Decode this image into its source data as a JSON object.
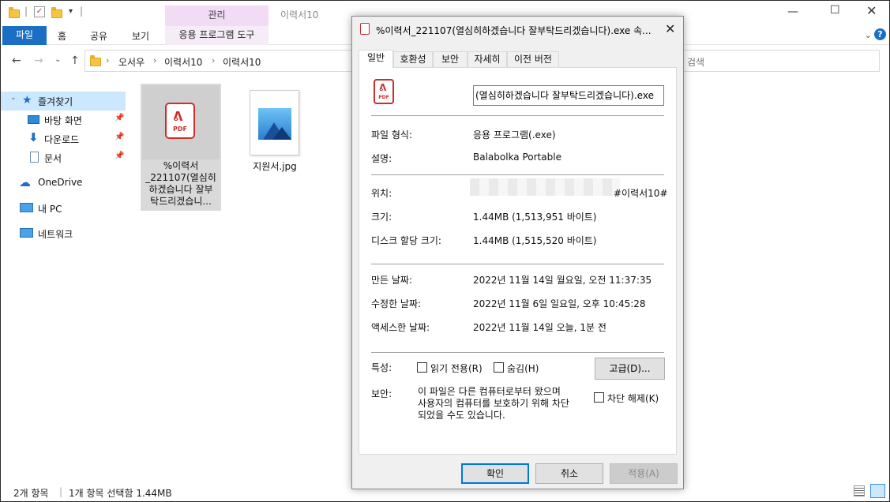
{
  "explorer": {
    "title_path": "이력서10",
    "manage_tab": "관리",
    "ribbon_tabs": {
      "file": "파일",
      "home": "홈",
      "share": "공유",
      "view": "보기",
      "app_tools": "응용 프로그램 도구"
    },
    "breadcrumb": [
      "오서우",
      "이력서10",
      "이력서10"
    ],
    "search_placeholder": "검색",
    "sidebar": {
      "quick_access": "즐겨찾기",
      "desktop": "바탕 화면",
      "downloads": "다운로드",
      "documents": "문서",
      "onedrive": "OneDrive",
      "this_pc": "내 PC",
      "network": "네트워크"
    },
    "files": [
      {
        "name_lines": [
          "%이력서",
          "_221107(열심히",
          "하겠습니다 잘부",
          "탁드리겠습니..."
        ],
        "icon_label": "PDF"
      },
      {
        "name": "지원서.jpg"
      }
    ],
    "status": {
      "item_count": "2개 항목",
      "selection": "1개 항목 선택함 1.44MB"
    }
  },
  "dialog": {
    "title": "%이력서_221107(열심히하겠습니다 잘부탁드리겠습니다).exe 속...",
    "tabs": [
      "일반",
      "호환성",
      "보안",
      "자세히",
      "이전 버전"
    ],
    "pdf_icon_text": "PDF",
    "filename_value": "(열심히하겠습니다 잘부탁드리겠습니다).exe",
    "fields": {
      "file_type_label": "파일 형식:",
      "file_type_value": "응용 프로그램(.exe)",
      "description_label": "설명:",
      "description_value": "Balabolka Portable",
      "location_label": "위치:",
      "location_value": "#이력서10#",
      "size_label": "크기:",
      "size_value": "1.44MB (1,513,951 바이트)",
      "disk_size_label": "디스크 할당 크기:",
      "disk_size_value": "1.44MB (1,515,520 바이트)",
      "created_label": "만든 날짜:",
      "created_value": "2022년 11월 14일 월요일, 오전 11:37:35",
      "modified_label": "수정한 날짜:",
      "modified_value": "2022년 11월 6일 일요일, 오후 10:45:28",
      "accessed_label": "액세스한 날짜:",
      "accessed_value": "2022년 11월 14일 오늘, 1분 전",
      "attributes_label": "특성:",
      "readonly_label": "읽기 전용(R)",
      "hidden_label": "숨김(H)",
      "advanced_button": "고급(D)...",
      "security_label": "보안:",
      "security_msg_lines": [
        "이 파일은 다른 컴퓨터로부터 왔으며",
        "사용자의 컴퓨터를 보호하기 위해 차단",
        "되었을 수도 있습니다."
      ],
      "unblock_label": "차단 해제(K)"
    },
    "buttons": {
      "ok": "확인",
      "cancel": "취소",
      "apply": "적용(A)"
    }
  }
}
